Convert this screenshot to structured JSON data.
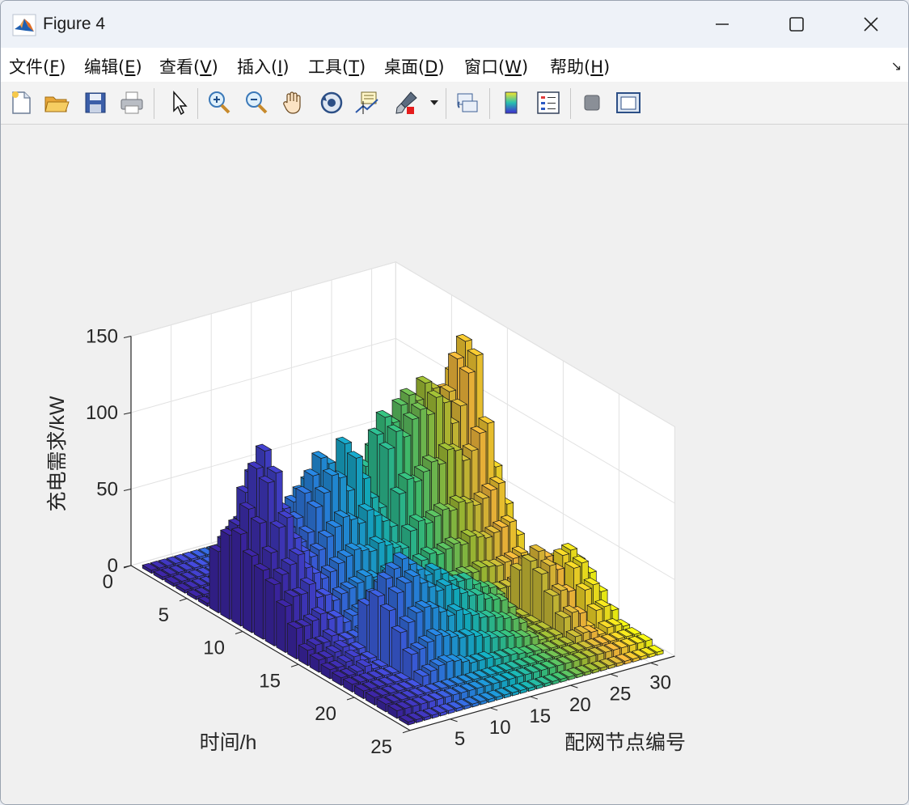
{
  "window": {
    "title": "Figure 4"
  },
  "menu": [
    {
      "label": "文件(",
      "key": "F",
      "tail": ")"
    },
    {
      "label": "编辑(",
      "key": "E",
      "tail": ")"
    },
    {
      "label": "查看(",
      "key": "V",
      "tail": ")"
    },
    {
      "label": "插入(",
      "key": "I",
      "tail": ")"
    },
    {
      "label": "工具(",
      "key": "T",
      "tail": ")"
    },
    {
      "label": "桌面(",
      "key": "D",
      "tail": ")"
    },
    {
      "label": "窗口(",
      "key": "W",
      "tail": ")"
    },
    {
      "label": "帮助(",
      "key": "H",
      "tail": ")"
    }
  ],
  "toolbar_icons": [
    "new-file-icon",
    "open-folder-icon",
    "save-icon",
    "print-icon",
    "pointer-icon",
    "zoom-in-icon",
    "zoom-out-icon",
    "pan-hand-icon",
    "rotate-3d-icon",
    "data-cursor-icon",
    "brush-icon",
    "link-plot-icon",
    "colorbar-icon",
    "legend-icon",
    "hide-plot-tools-icon",
    "show-plot-tools-icon"
  ],
  "chart_data": {
    "type": "bar3",
    "zlabel": "充电需求/kW",
    "ylabel": "时间/h",
    "xlabel": "配网节点编号",
    "z_ticks": [
      0,
      50,
      100,
      150
    ],
    "y_ticks": [
      0,
      5,
      10,
      15,
      20,
      25
    ],
    "x_ticks": [
      5,
      10,
      15,
      20,
      25,
      30
    ],
    "zlim": [
      0,
      150
    ],
    "xlim": [
      0,
      33
    ],
    "ylim": [
      0,
      25
    ],
    "nodes": 32,
    "hours": 24,
    "colormap": "parula",
    "grid": true,
    "approx_bar_values": {
      "description_free": true,
      "values": [
        [
          2,
          2,
          2,
          2,
          2,
          2,
          40,
          55,
          60,
          50,
          45,
          40,
          30,
          20,
          10,
          8,
          6,
          5,
          5,
          5,
          5,
          5,
          5,
          2
        ],
        [
          2,
          2,
          2,
          2,
          2,
          2,
          45,
          60,
          75,
          70,
          55,
          45,
          35,
          20,
          12,
          8,
          6,
          5,
          5,
          5,
          5,
          5,
          5,
          2
        ],
        [
          2,
          2,
          2,
          2,
          2,
          2,
          50,
          80,
          100,
          95,
          70,
          50,
          35,
          22,
          12,
          10,
          8,
          6,
          5,
          5,
          5,
          5,
          5,
          2
        ],
        [
          2,
          2,
          2,
          2,
          2,
          2,
          55,
          90,
          110,
          100,
          75,
          55,
          40,
          25,
          15,
          12,
          10,
          8,
          5,
          5,
          5,
          5,
          5,
          2
        ],
        [
          2,
          2,
          2,
          2,
          2,
          2,
          50,
          70,
          80,
          75,
          60,
          45,
          30,
          20,
          10,
          8,
          6,
          5,
          5,
          5,
          5,
          5,
          5,
          2
        ],
        [
          2,
          2,
          2,
          2,
          2,
          2,
          40,
          55,
          60,
          55,
          50,
          40,
          30,
          20,
          10,
          8,
          6,
          5,
          5,
          5,
          5,
          5,
          5,
          2
        ],
        [
          2,
          2,
          2,
          2,
          2,
          2,
          30,
          45,
          55,
          50,
          45,
          35,
          25,
          15,
          10,
          35,
          45,
          40,
          30,
          20,
          10,
          5,
          5,
          2
        ],
        [
          2,
          2,
          2,
          2,
          2,
          2,
          35,
          50,
          60,
          55,
          48,
          38,
          28,
          18,
          12,
          40,
          55,
          50,
          35,
          22,
          12,
          5,
          5,
          2
        ],
        [
          2,
          2,
          2,
          2,
          2,
          2,
          40,
          65,
          75,
          70,
          55,
          42,
          30,
          20,
          14,
          45,
          60,
          55,
          40,
          25,
          14,
          5,
          5,
          2
        ],
        [
          2,
          2,
          2,
          2,
          2,
          2,
          45,
          70,
          85,
          78,
          60,
          45,
          32,
          22,
          15,
          50,
          65,
          58,
          42,
          28,
          15,
          5,
          5,
          2
        ],
        [
          2,
          2,
          2,
          2,
          2,
          2,
          50,
          75,
          95,
          88,
          65,
          48,
          35,
          24,
          16,
          48,
          60,
          52,
          40,
          26,
          14,
          5,
          5,
          2
        ],
        [
          2,
          2,
          2,
          2,
          2,
          2,
          45,
          70,
          90,
          85,
          62,
          46,
          33,
          22,
          15,
          42,
          55,
          48,
          36,
          24,
          12,
          5,
          5,
          2
        ],
        [
          2,
          2,
          2,
          2,
          2,
          2,
          40,
          60,
          80,
          75,
          58,
          44,
          30,
          20,
          14,
          38,
          50,
          44,
          32,
          22,
          10,
          5,
          5,
          2
        ],
        [
          2,
          2,
          2,
          2,
          2,
          2,
          45,
          70,
          100,
          95,
          65,
          48,
          34,
          22,
          15,
          40,
          52,
          46,
          34,
          22,
          10,
          5,
          5,
          2
        ],
        [
          2,
          2,
          2,
          2,
          2,
          2,
          40,
          62,
          85,
          80,
          60,
          45,
          32,
          20,
          14,
          36,
          48,
          42,
          30,
          20,
          10,
          5,
          5,
          2
        ],
        [
          2,
          2,
          2,
          2,
          2,
          2,
          35,
          55,
          70,
          66,
          55,
          42,
          30,
          20,
          12,
          30,
          42,
          38,
          28,
          18,
          8,
          5,
          5,
          2
        ],
        [
          2,
          2,
          2,
          2,
          2,
          2,
          30,
          50,
          60,
          58,
          50,
          40,
          28,
          18,
          12,
          28,
          40,
          35,
          25,
          16,
          8,
          5,
          5,
          2
        ],
        [
          2,
          2,
          2,
          2,
          2,
          2,
          45,
          75,
          100,
          95,
          70,
          50,
          35,
          22,
          14,
          30,
          40,
          34,
          24,
          15,
          8,
          5,
          5,
          2
        ],
        [
          2,
          2,
          2,
          2,
          2,
          2,
          50,
          85,
          110,
          105,
          78,
          55,
          38,
          24,
          15,
          26,
          35,
          30,
          22,
          14,
          7,
          5,
          5,
          2
        ],
        [
          2,
          2,
          2,
          2,
          2,
          2,
          45,
          80,
          105,
          100,
          75,
          52,
          36,
          22,
          14,
          24,
          32,
          28,
          20,
          12,
          6,
          5,
          5,
          2
        ],
        [
          2,
          2,
          2,
          2,
          2,
          2,
          48,
          90,
          115,
          110,
          80,
          55,
          38,
          24,
          15,
          22,
          30,
          26,
          18,
          11,
          6,
          5,
          5,
          2
        ],
        [
          2,
          2,
          2,
          2,
          2,
          2,
          50,
          95,
          120,
          115,
          85,
          58,
          40,
          25,
          16,
          18,
          24,
          20,
          14,
          9,
          5,
          5,
          5,
          2
        ],
        [
          2,
          2,
          2,
          2,
          2,
          2,
          45,
          90,
          115,
          110,
          82,
          56,
          38,
          24,
          15,
          6,
          6,
          6,
          6,
          6,
          5,
          5,
          5,
          2
        ],
        [
          2,
          2,
          2,
          2,
          2,
          2,
          50,
          100,
          125,
          120,
          90,
          60,
          42,
          26,
          16,
          6,
          6,
          6,
          6,
          6,
          5,
          5,
          5,
          2
        ],
        [
          2,
          2,
          2,
          2,
          2,
          2,
          48,
          95,
          120,
          115,
          88,
          58,
          40,
          25,
          15,
          6,
          6,
          6,
          6,
          6,
          5,
          5,
          5,
          2
        ],
        [
          2,
          2,
          2,
          2,
          2,
          2,
          40,
          80,
          105,
          100,
          80,
          55,
          38,
          24,
          15,
          30,
          40,
          36,
          26,
          16,
          8,
          5,
          5,
          2
        ],
        [
          2,
          2,
          2,
          2,
          2,
          2,
          45,
          90,
          115,
          110,
          85,
          58,
          40,
          25,
          16,
          34,
          45,
          40,
          28,
          18,
          9,
          5,
          5,
          2
        ],
        [
          2,
          2,
          2,
          2,
          2,
          2,
          50,
          110,
          135,
          130,
          95,
          62,
          42,
          26,
          16,
          30,
          40,
          36,
          26,
          16,
          8,
          5,
          5,
          2
        ],
        [
          2,
          2,
          2,
          2,
          2,
          2,
          52,
          120,
          145,
          140,
          100,
          65,
          44,
          28,
          18,
          6,
          6,
          6,
          6,
          6,
          5,
          5,
          5,
          2
        ],
        [
          2,
          2,
          2,
          2,
          2,
          2,
          40,
          70,
          90,
          86,
          70,
          50,
          34,
          20,
          12,
          28,
          38,
          34,
          24,
          15,
          8,
          5,
          5,
          2
        ],
        [
          2,
          2,
          2,
          2,
          2,
          2,
          20,
          30,
          40,
          38,
          32,
          25,
          18,
          12,
          8,
          30,
          40,
          36,
          26,
          16,
          8,
          5,
          5,
          2
        ],
        [
          2,
          2,
          2,
          2,
          2,
          2,
          8,
          10,
          12,
          10,
          8,
          6,
          5,
          5,
          5,
          25,
          32,
          28,
          20,
          12,
          6,
          5,
          5,
          2
        ]
      ]
    }
  }
}
